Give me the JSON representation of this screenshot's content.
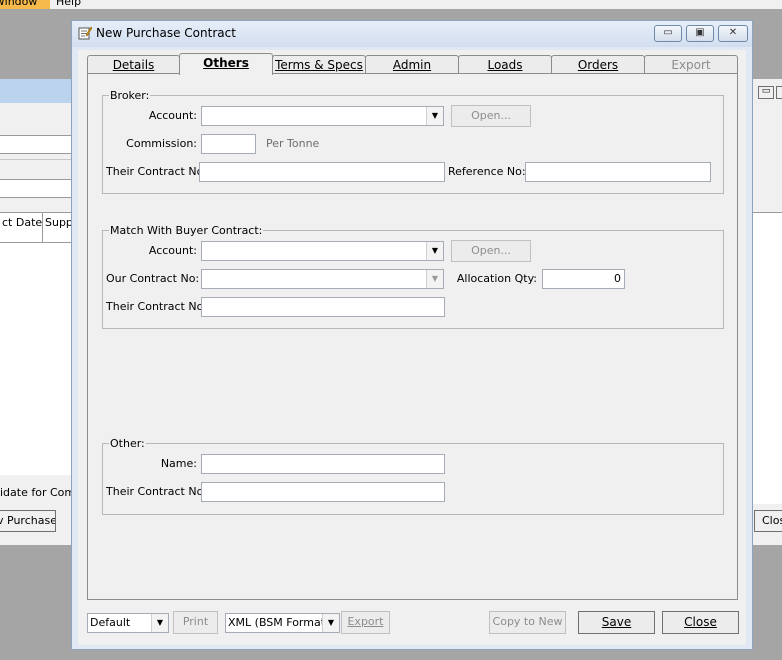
{
  "background": {
    "menu": [
      "Window",
      "Help"
    ],
    "grid_headers": [
      "ct Date",
      "Supp"
    ],
    "status_text": "idate for Compl",
    "new_purchase_button": "v Purchase",
    "close_button": "Clos"
  },
  "dialog": {
    "title": "New Purchase Contract",
    "caption_buttons": {
      "minimize": "▭",
      "maximize": "▣",
      "close": "✕"
    },
    "tabs": [
      {
        "label": "Details",
        "state": "normal"
      },
      {
        "label": "Others",
        "state": "selected"
      },
      {
        "label": "Terms & Specs",
        "state": "normal"
      },
      {
        "label": "Admin",
        "state": "normal"
      },
      {
        "label": "Loads",
        "state": "normal"
      },
      {
        "label": "Orders",
        "state": "normal"
      },
      {
        "label": "Export",
        "state": "disabled"
      }
    ]
  },
  "broker": {
    "group_label": "Broker:",
    "account_label": "Account:",
    "account_value": "",
    "open_button": "Open...",
    "commission_label": "Commission:",
    "commission_value": "",
    "commission_unit": "Per Tonne",
    "their_contract_label": "Their Contract No:",
    "their_contract_value": "",
    "reference_label": "Reference No:",
    "reference_value": ""
  },
  "match": {
    "group_label": "Match With Buyer Contract:",
    "account_label": "Account:",
    "account_value": "",
    "open_button": "Open...",
    "our_contract_label": "Our Contract No:",
    "our_contract_value": "",
    "allocation_label": "Allocation Qty:",
    "allocation_value": "0",
    "their_contract_label": "Their Contract No:",
    "their_contract_value": ""
  },
  "other": {
    "group_label": "Other:",
    "name_label": "Name:",
    "name_value": "",
    "their_contract_label": "Their Contract No:",
    "their_contract_value": ""
  },
  "footer": {
    "report_select": "Default",
    "print_button": "Print",
    "format_select": "XML (BSM Format)",
    "export_button": "Export",
    "copy_button": "Copy to New",
    "save_button": "Save",
    "close_button": "Close"
  }
}
